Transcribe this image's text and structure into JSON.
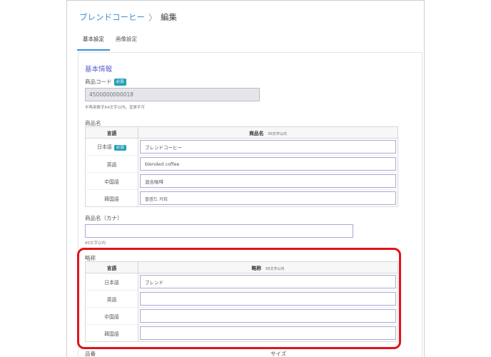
{
  "breadcrumb": {
    "parent": "ブレンドコーヒー",
    "separator": "〉",
    "current": "編集"
  },
  "tabs": [
    {
      "label": "基本設定",
      "active": true
    },
    {
      "label": "画像設定",
      "active": false
    }
  ],
  "section_title": "基本情報",
  "required_badge": "必須",
  "product_code": {
    "label": "商品コード",
    "value": "4500000000018",
    "hint": "半角英数字64文字以内。変更不可"
  },
  "product_name": {
    "label": "商品名",
    "header_lang": "言語",
    "header_name": "商品名",
    "header_limit": "50文字以内",
    "rows": [
      {
        "lang": "日本語",
        "required": true,
        "value": "ブレンドコーヒー"
      },
      {
        "lang": "英語",
        "required": false,
        "value": "blended coffee"
      },
      {
        "lang": "中国語",
        "required": false,
        "value": "混合咖啡"
      },
      {
        "lang": "韓国語",
        "required": false,
        "value": "블렌드 커피"
      }
    ]
  },
  "product_kana": {
    "label": "商品名（カナ）",
    "value": "",
    "hint": "80文字以内"
  },
  "abbreviation": {
    "label": "略称",
    "header_lang": "言語",
    "header_name": "略称",
    "header_limit": "50文字以内",
    "rows": [
      {
        "lang": "日本語",
        "value": "ブレンド"
      },
      {
        "lang": "英語",
        "value": ""
      },
      {
        "lang": "中国語",
        "value": ""
      },
      {
        "lang": "韓国語",
        "value": ""
      }
    ]
  },
  "bottom_labels": {
    "left": "品番",
    "right": "サイズ"
  },
  "colors": {
    "accent": "#3b8fd6",
    "section": "#5a5fcf",
    "badge": "#24a0b8",
    "highlight": "#e1131a"
  }
}
